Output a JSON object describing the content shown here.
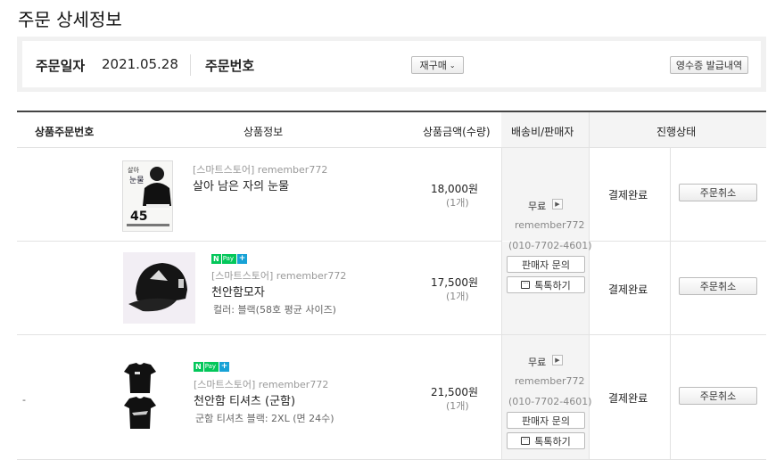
{
  "page": {
    "title": "주문 상세정보"
  },
  "summary": {
    "order_date_label": "주문일자",
    "order_date": "2021.05.28",
    "order_no_label": "주문번호",
    "reorder_button": "재구매",
    "receipt_button": "영수증 발급내역"
  },
  "table": {
    "headers": [
      "상품주문번호",
      "상품정보",
      "상품금액(수량)",
      "배송비/판매자",
      "진행상태"
    ]
  },
  "items": [
    {
      "order_no": "",
      "store": "[스마트스토어] remember772",
      "name": "살아 남은 자의 눈물",
      "option": "",
      "price": "18,000원",
      "qty": "(1개)",
      "npay": false,
      "status": "결제완료",
      "cancel_button": "주문취소"
    },
    {
      "order_no": "",
      "store": "[스마트스토어] remember772",
      "name": "천안함모자",
      "option": "컬러: 블랙(58호 평균 사이즈)",
      "price": "17,500원",
      "qty": "(1개)",
      "npay": true,
      "status": "결제완료",
      "cancel_button": "주문취소"
    },
    {
      "order_no": "-",
      "store": "[스마트스토어] remember772",
      "name": "천안함 티셔츠 (군함)",
      "option": "군함 티셔츠 블랙: 2XL (면 24수)",
      "price": "21,500원",
      "qty": "(1개)",
      "npay": true,
      "status": "결제완료",
      "cancel_button": "주문취소"
    }
  ],
  "npay_badge": {
    "n": "N",
    "pay": "Pay",
    "plus": "+"
  },
  "shipping": [
    {
      "fee": "무료",
      "seller": "remember772",
      "phone": "(010-7702-4601)",
      "inquiry_button": "판매자 문의",
      "talk_button": "톡톡하기"
    },
    {
      "fee": "무료",
      "seller": "remember772",
      "phone": "(010-7702-4601)",
      "inquiry_button": "판매자 문의",
      "talk_button": "톡톡하기"
    }
  ],
  "icons": {
    "dropdown": "chevron-down-icon",
    "arrow": "arrow-right-icon",
    "talk": "chat-icon"
  },
  "colors": {
    "npay_green": "#03c75a",
    "npay_blue": "#17a2d6",
    "header_rule": "#444444"
  }
}
